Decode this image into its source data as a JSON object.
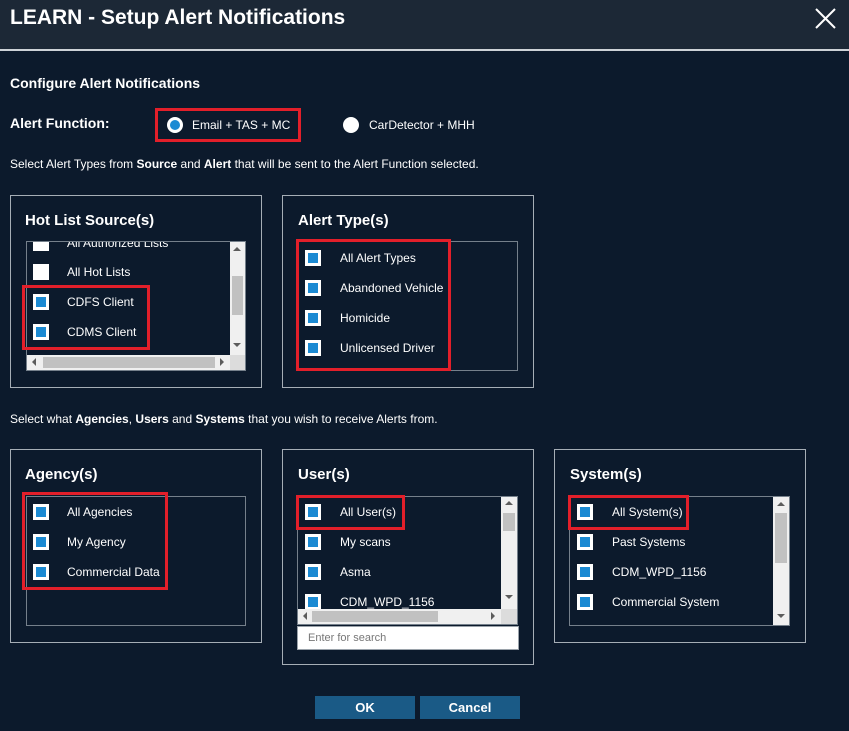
{
  "dialog": {
    "title": "LEARN - Setup Alert Notifications",
    "close_icon": "close-icon"
  },
  "configure": {
    "heading": "Configure Alert Notifications"
  },
  "alert_function": {
    "label": "Alert Function:",
    "options": [
      {
        "label": "Email + TAS + MC",
        "selected": true
      },
      {
        "label": "CarDetector + MHH",
        "selected": false
      }
    ]
  },
  "alert_instruction": {
    "part1": "Select Alert Types from ",
    "source": "Source",
    "part2": " and ",
    "alert": "Alert",
    "part3": " that will be sent to the Alert Function selected."
  },
  "hot_list_sources": {
    "title": "Hot List Source(s)",
    "items": [
      {
        "label": "All Authorized Lists",
        "checked": false
      },
      {
        "label": "All Hot Lists",
        "checked": false
      },
      {
        "label": "CDFS Client",
        "checked": true
      },
      {
        "label": "CDMS Client",
        "checked": true
      }
    ]
  },
  "alert_types": {
    "title": "Alert Type(s)",
    "items": [
      {
        "label": "All Alert Types",
        "checked": true
      },
      {
        "label": "Abandoned Vehicle",
        "checked": true
      },
      {
        "label": "Homicide",
        "checked": true
      },
      {
        "label": "Unlicensed Driver",
        "checked": true
      }
    ]
  },
  "recipient_instruction": {
    "part1": "Select what ",
    "agencies": "Agencies",
    "part2": ", ",
    "users": "Users",
    "part3": " and ",
    "systems": "Systems",
    "part4": " that you wish to receive Alerts from."
  },
  "agencies": {
    "title": "Agency(s)",
    "items": [
      {
        "label": "All Agencies",
        "checked": true
      },
      {
        "label": "My Agency",
        "checked": true
      },
      {
        "label": "Commercial Data",
        "checked": true
      }
    ]
  },
  "users": {
    "title": "User(s)",
    "items": [
      {
        "label": "All User(s)",
        "checked": true
      },
      {
        "label": "My scans",
        "checked": true
      },
      {
        "label": "Asma",
        "checked": true
      },
      {
        "label": "CDM_WPD_1156",
        "checked": true
      }
    ],
    "search_placeholder": "Enter for search"
  },
  "systems": {
    "title": "System(s)",
    "items": [
      {
        "label": "All System(s)",
        "checked": true
      },
      {
        "label": "Past Systems",
        "checked": true
      },
      {
        "label": "CDM_WPD_1156",
        "checked": true
      },
      {
        "label": "Commercial System",
        "checked": true
      }
    ]
  },
  "buttons": {
    "ok": "OK",
    "cancel": "Cancel"
  },
  "colors": {
    "background": "#0c1a2c",
    "title_bar": "#1c2836",
    "highlight": "#e21f2a",
    "checkbox_fill": "#1b8ad3",
    "button": "#1a5a86"
  }
}
